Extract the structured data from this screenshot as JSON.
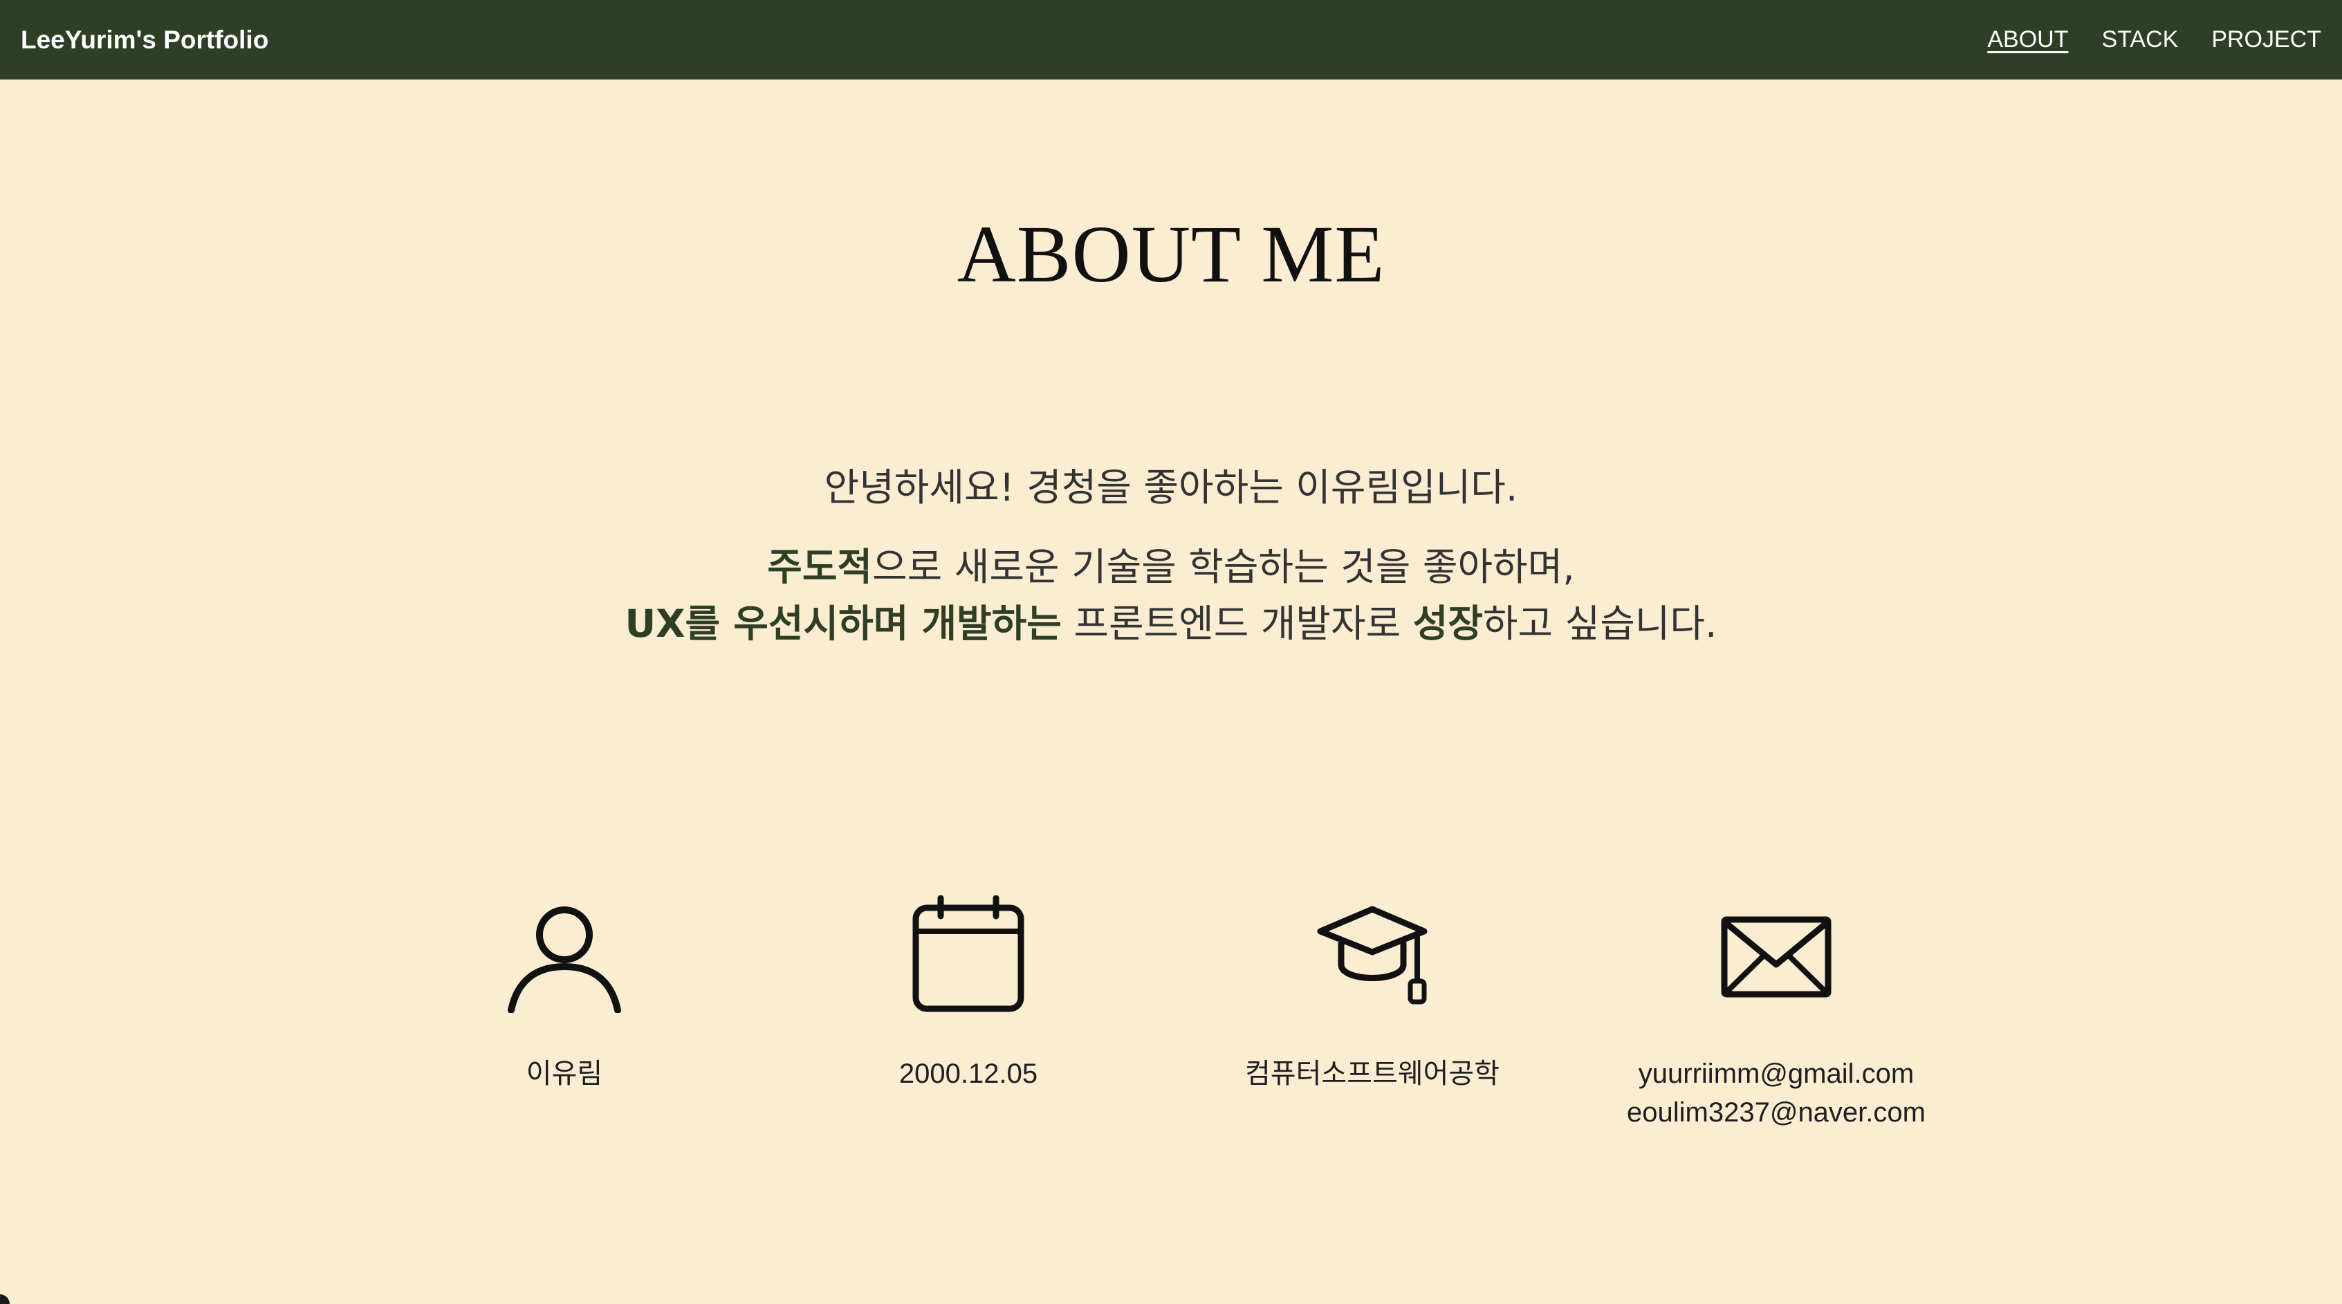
{
  "nav": {
    "brand": "LeeYurim's Portfolio",
    "links": [
      {
        "label": "ABOUT",
        "active": true
      },
      {
        "label": "STACK",
        "active": false
      },
      {
        "label": "PROJECT",
        "active": false
      }
    ],
    "background": "#2f3f26"
  },
  "about": {
    "title": "ABOUT ME",
    "line1": "안녕하세요! 경청을 좋아하는 이유림입니다.",
    "line2_strong": "주도적",
    "line2_rest": "으로 새로운 기술을 학습하는 것을 좋아하며,",
    "line3_strong1": "UX를 우선시하며 개발하는",
    "line3_mid": " 프론트엔드 개발자로 ",
    "line3_strong2": "성장",
    "line3_rest": "하고 싶습니다."
  },
  "info": {
    "name": {
      "icon": "person-icon",
      "text": "이유림"
    },
    "birth": {
      "icon": "calendar-icon",
      "text": "2000.12.05"
    },
    "major": {
      "icon": "graduation-cap-icon",
      "text": "컴퓨터소프트웨어공학"
    },
    "email": {
      "icon": "envelope-icon",
      "email1": "yuurriimm@gmail.com",
      "email2": "eoulim3237@naver.com"
    }
  },
  "colors": {
    "background": "#fbedd2",
    "accent": "#2f3f26"
  }
}
